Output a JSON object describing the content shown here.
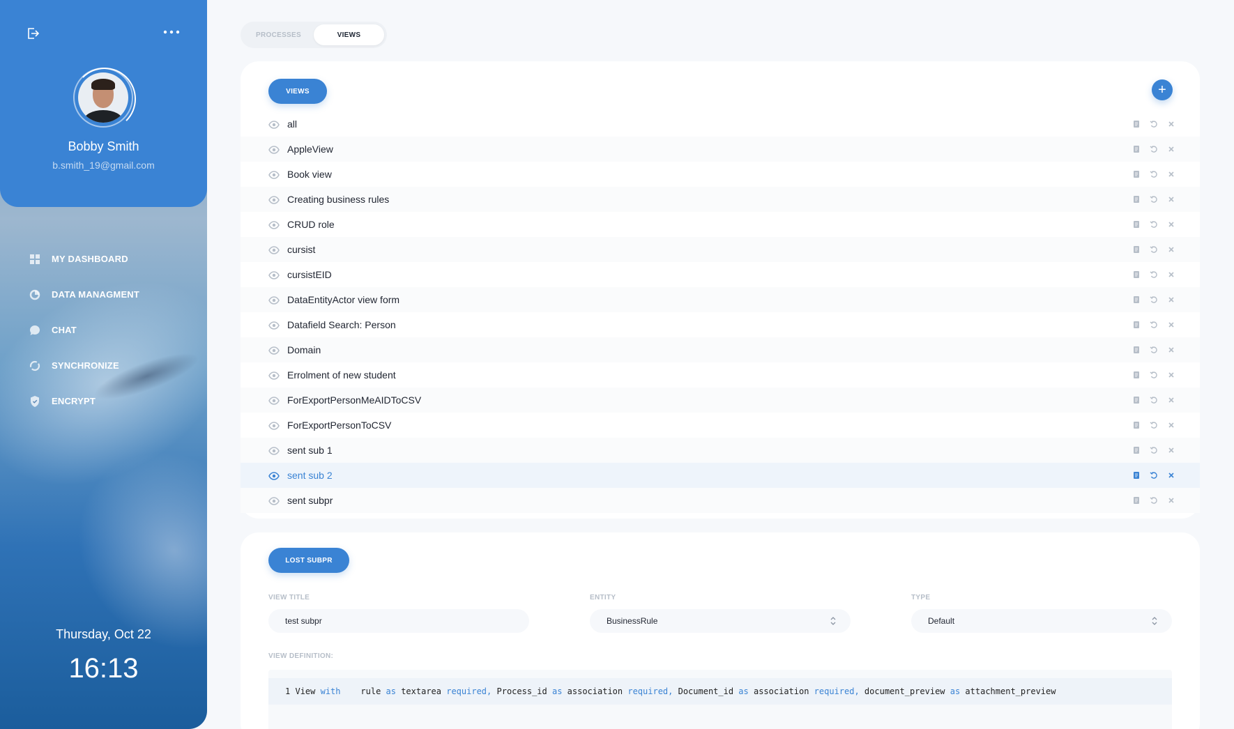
{
  "user": {
    "name": "Bobby Smith",
    "email": "b.smith_19@gmail.com"
  },
  "nav": [
    {
      "label": "MY DASHBOARD",
      "icon": "dashboard-icon"
    },
    {
      "label": "DATA MANAGMENT",
      "icon": "data-icon"
    },
    {
      "label": "CHAT",
      "icon": "chat-icon"
    },
    {
      "label": "SYNCHRONIZE",
      "icon": "sync-icon"
    },
    {
      "label": "ENCRYPT",
      "icon": "shield-icon"
    }
  ],
  "clock": {
    "date": "Thursday, Oct 22",
    "time": "16:13"
  },
  "tabs": [
    {
      "label": "PROCESSES",
      "active": false
    },
    {
      "label": "VIEWS",
      "active": true
    }
  ],
  "views_panel": {
    "pill": "VIEWS",
    "add_label": "+",
    "items": [
      "all",
      "AppleView",
      "Book view",
      "Creating business rules",
      "CRUD role",
      "cursist",
      "cursistEID",
      "DataEntityActor view form",
      "Datafield Search: Person",
      "Domain",
      "Errolment of new student",
      "ForExportPersonMeAIDToCSV",
      "ForExportPersonToCSV",
      "sent sub 1",
      "sent sub 2",
      "sent subpr"
    ],
    "selected": "sent sub 2"
  },
  "detail": {
    "pill": "LOST SUBPR",
    "view_title_label": "VIEW TITLE",
    "view_title_value": "test subpr",
    "entity_label": "ENTITY",
    "entity_value": "BusinessRule",
    "type_label": "TYPE",
    "type_value": "Default",
    "definition_label": "VIEW DEFINITION:",
    "code": {
      "line_no": "1",
      "tokens": [
        {
          "t": "View ",
          "kw": false
        },
        {
          "t": "with",
          "kw": true
        },
        {
          "t": "    rule ",
          "kw": false
        },
        {
          "t": "as",
          "kw": true
        },
        {
          "t": " textarea ",
          "kw": false
        },
        {
          "t": "required,",
          "kw": true
        },
        {
          "t": " Process_id ",
          "kw": false
        },
        {
          "t": "as",
          "kw": true
        },
        {
          "t": " association ",
          "kw": false
        },
        {
          "t": "required,",
          "kw": true
        },
        {
          "t": " Document_id ",
          "kw": false
        },
        {
          "t": "as",
          "kw": true
        },
        {
          "t": " association ",
          "kw": false
        },
        {
          "t": "required,",
          "kw": true
        },
        {
          "t": " document_preview ",
          "kw": false
        },
        {
          "t": "as",
          "kw": true
        },
        {
          "t": " attachment_preview",
          "kw": false
        }
      ]
    }
  },
  "colors": {
    "accent": "#3a83d4",
    "muted_icon": "#b6bec8"
  }
}
